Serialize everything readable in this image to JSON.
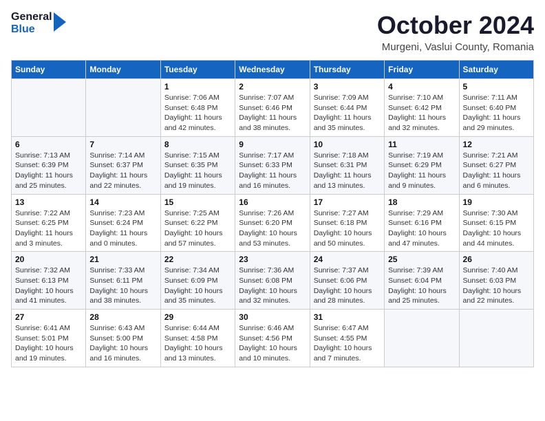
{
  "header": {
    "logo_line1": "General",
    "logo_line2": "Blue",
    "month": "October 2024",
    "location": "Murgeni, Vaslui County, Romania"
  },
  "weekdays": [
    "Sunday",
    "Monday",
    "Tuesday",
    "Wednesday",
    "Thursday",
    "Friday",
    "Saturday"
  ],
  "weeks": [
    [
      {
        "day": "",
        "info": ""
      },
      {
        "day": "",
        "info": ""
      },
      {
        "day": "1",
        "info": "Sunrise: 7:06 AM\nSunset: 6:48 PM\nDaylight: 11 hours and 42 minutes."
      },
      {
        "day": "2",
        "info": "Sunrise: 7:07 AM\nSunset: 6:46 PM\nDaylight: 11 hours and 38 minutes."
      },
      {
        "day": "3",
        "info": "Sunrise: 7:09 AM\nSunset: 6:44 PM\nDaylight: 11 hours and 35 minutes."
      },
      {
        "day": "4",
        "info": "Sunrise: 7:10 AM\nSunset: 6:42 PM\nDaylight: 11 hours and 32 minutes."
      },
      {
        "day": "5",
        "info": "Sunrise: 7:11 AM\nSunset: 6:40 PM\nDaylight: 11 hours and 29 minutes."
      }
    ],
    [
      {
        "day": "6",
        "info": "Sunrise: 7:13 AM\nSunset: 6:39 PM\nDaylight: 11 hours and 25 minutes."
      },
      {
        "day": "7",
        "info": "Sunrise: 7:14 AM\nSunset: 6:37 PM\nDaylight: 11 hours and 22 minutes."
      },
      {
        "day": "8",
        "info": "Sunrise: 7:15 AM\nSunset: 6:35 PM\nDaylight: 11 hours and 19 minutes."
      },
      {
        "day": "9",
        "info": "Sunrise: 7:17 AM\nSunset: 6:33 PM\nDaylight: 11 hours and 16 minutes."
      },
      {
        "day": "10",
        "info": "Sunrise: 7:18 AM\nSunset: 6:31 PM\nDaylight: 11 hours and 13 minutes."
      },
      {
        "day": "11",
        "info": "Sunrise: 7:19 AM\nSunset: 6:29 PM\nDaylight: 11 hours and 9 minutes."
      },
      {
        "day": "12",
        "info": "Sunrise: 7:21 AM\nSunset: 6:27 PM\nDaylight: 11 hours and 6 minutes."
      }
    ],
    [
      {
        "day": "13",
        "info": "Sunrise: 7:22 AM\nSunset: 6:25 PM\nDaylight: 11 hours and 3 minutes."
      },
      {
        "day": "14",
        "info": "Sunrise: 7:23 AM\nSunset: 6:24 PM\nDaylight: 11 hours and 0 minutes."
      },
      {
        "day": "15",
        "info": "Sunrise: 7:25 AM\nSunset: 6:22 PM\nDaylight: 10 hours and 57 minutes."
      },
      {
        "day": "16",
        "info": "Sunrise: 7:26 AM\nSunset: 6:20 PM\nDaylight: 10 hours and 53 minutes."
      },
      {
        "day": "17",
        "info": "Sunrise: 7:27 AM\nSunset: 6:18 PM\nDaylight: 10 hours and 50 minutes."
      },
      {
        "day": "18",
        "info": "Sunrise: 7:29 AM\nSunset: 6:16 PM\nDaylight: 10 hours and 47 minutes."
      },
      {
        "day": "19",
        "info": "Sunrise: 7:30 AM\nSunset: 6:15 PM\nDaylight: 10 hours and 44 minutes."
      }
    ],
    [
      {
        "day": "20",
        "info": "Sunrise: 7:32 AM\nSunset: 6:13 PM\nDaylight: 10 hours and 41 minutes."
      },
      {
        "day": "21",
        "info": "Sunrise: 7:33 AM\nSunset: 6:11 PM\nDaylight: 10 hours and 38 minutes."
      },
      {
        "day": "22",
        "info": "Sunrise: 7:34 AM\nSunset: 6:09 PM\nDaylight: 10 hours and 35 minutes."
      },
      {
        "day": "23",
        "info": "Sunrise: 7:36 AM\nSunset: 6:08 PM\nDaylight: 10 hours and 32 minutes."
      },
      {
        "day": "24",
        "info": "Sunrise: 7:37 AM\nSunset: 6:06 PM\nDaylight: 10 hours and 28 minutes."
      },
      {
        "day": "25",
        "info": "Sunrise: 7:39 AM\nSunset: 6:04 PM\nDaylight: 10 hours and 25 minutes."
      },
      {
        "day": "26",
        "info": "Sunrise: 7:40 AM\nSunset: 6:03 PM\nDaylight: 10 hours and 22 minutes."
      }
    ],
    [
      {
        "day": "27",
        "info": "Sunrise: 6:41 AM\nSunset: 5:01 PM\nDaylight: 10 hours and 19 minutes."
      },
      {
        "day": "28",
        "info": "Sunrise: 6:43 AM\nSunset: 5:00 PM\nDaylight: 10 hours and 16 minutes."
      },
      {
        "day": "29",
        "info": "Sunrise: 6:44 AM\nSunset: 4:58 PM\nDaylight: 10 hours and 13 minutes."
      },
      {
        "day": "30",
        "info": "Sunrise: 6:46 AM\nSunset: 4:56 PM\nDaylight: 10 hours and 10 minutes."
      },
      {
        "day": "31",
        "info": "Sunrise: 6:47 AM\nSunset: 4:55 PM\nDaylight: 10 hours and 7 minutes."
      },
      {
        "day": "",
        "info": ""
      },
      {
        "day": "",
        "info": ""
      }
    ]
  ]
}
